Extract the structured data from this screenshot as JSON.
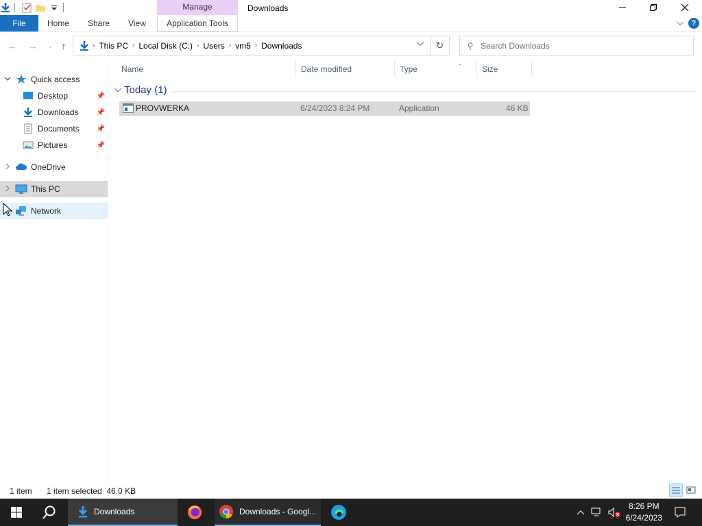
{
  "window": {
    "title": "Downloads",
    "contextual_group": "Manage",
    "controls": {
      "minimize": "minimize",
      "restore": "restore",
      "close": "close"
    }
  },
  "ribbon": {
    "tabs": [
      "File",
      "Home",
      "Share",
      "View",
      "Application Tools"
    ]
  },
  "address": {
    "crumbs": [
      "This PC",
      "Local Disk (C:)",
      "Users",
      "vm5",
      "Downloads"
    ]
  },
  "search": {
    "placeholder": "Search Downloads"
  },
  "nav_pane": {
    "items": [
      {
        "label": "Quick access",
        "icon": "star-icon"
      },
      {
        "label": "Desktop",
        "icon": "desktop-icon",
        "pinned": true
      },
      {
        "label": "Downloads",
        "icon": "download-arrow-icon",
        "pinned": true
      },
      {
        "label": "Documents",
        "icon": "document-icon",
        "pinned": true
      },
      {
        "label": "Pictures",
        "icon": "pictures-icon",
        "pinned": true
      },
      {
        "label": "OneDrive",
        "icon": "cloud-icon"
      },
      {
        "label": "This PC",
        "icon": "computer-icon"
      },
      {
        "label": "Network",
        "icon": "network-icon"
      }
    ]
  },
  "columns": [
    "Name",
    "Date modified",
    "Type",
    "Size"
  ],
  "group": {
    "title": "Today (1)"
  },
  "files": [
    {
      "name": "PROVWERKA",
      "date": "6/24/2023 8:24 PM",
      "type": "Application",
      "size": "46 KB"
    }
  ],
  "status": {
    "count": "1 item",
    "selection": "1 item selected  46.0 KB"
  },
  "taskbar": {
    "explorer_label": "Downloads",
    "chrome_label": "Downloads - Googl...",
    "time": "8:26 PM",
    "date": "6/24/2023"
  },
  "colors": {
    "accent": "#1a6fbf",
    "manage_tab": "#ead0f7",
    "selection": "#d9d9d9",
    "group_text": "#1e3287"
  }
}
